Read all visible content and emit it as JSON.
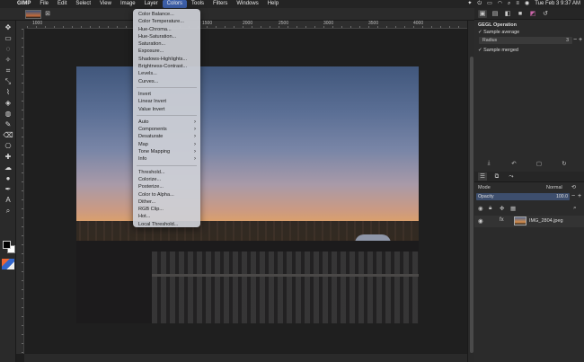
{
  "menubar": {
    "app": "GIMP",
    "items": [
      "File",
      "Edit",
      "Select",
      "View",
      "Image",
      "Layer",
      "Colors",
      "Tools",
      "Filters",
      "Windows",
      "Help"
    ],
    "active": "Colors",
    "datetime": "Tue Feb 3  9:37 AM"
  },
  "colors_menu": {
    "group1": [
      "Color Balance...",
      "Color Temperature...",
      "Hue-Chroma...",
      "Hue-Saturation...",
      "Saturation...",
      "Exposure...",
      "Shadows-Highlights...",
      "Brightness-Contrast...",
      "Levels...",
      "Curves..."
    ],
    "group2": [
      "Invert",
      "Linear Invert",
      "Value Invert"
    ],
    "group3": [
      "Auto",
      "Components",
      "Desaturate",
      "Map",
      "Tone Mapping",
      "Info"
    ],
    "group4": [
      "Threshold...",
      "Colorize...",
      "Posterize...",
      "Color to Alpha...",
      "Dither...",
      "RGB Clip...",
      "Hot...",
      "Local Threshold..."
    ]
  },
  "rulers": {
    "h_labels": [
      "1000",
      "1500",
      "2000",
      "2500",
      "3000",
      "3500",
      "4000"
    ]
  },
  "gegl": {
    "title": "GEGL Operation",
    "sample_average": "Sample average",
    "radius_label": "Radius",
    "radius_value": "3",
    "sample_merged": "Sample merged"
  },
  "layers": {
    "mode_label": "Mode",
    "mode_value": "Normal",
    "opacity_label": "Opacity",
    "opacity_value": "100.0",
    "layer_name": "IMG_2804.jpeg"
  }
}
